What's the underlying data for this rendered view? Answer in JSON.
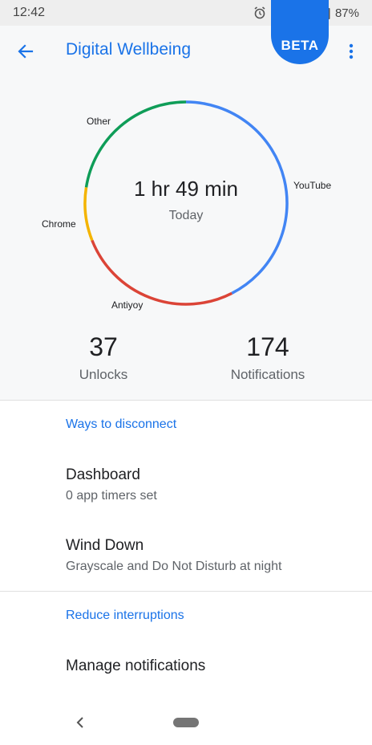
{
  "status_bar": {
    "time": "12:42",
    "battery": "87%",
    "icons": [
      "alarm-icon",
      "bluetooth-icon",
      "wifi-icon",
      "signal-icon",
      "battery-icon"
    ]
  },
  "app_bar": {
    "title": "Digital Wellbeing",
    "badge": "BETA"
  },
  "colors": {
    "accent": "#1a73e8",
    "youtube": "#4285f4",
    "antiyoy": "#db4437",
    "chrome": "#f4b400",
    "other": "#0f9d58"
  },
  "usage": {
    "total": "1 hr 49 min",
    "period": "Today",
    "segments": [
      {
        "app": "YouTube",
        "color": "#4285f4",
        "fraction": 0.425
      },
      {
        "app": "Antiyoy",
        "color": "#db4437",
        "fraction": 0.265
      },
      {
        "app": "Chrome",
        "color": "#f4b400",
        "fraction": 0.085
      },
      {
        "app": "Other",
        "color": "#0f9d58",
        "fraction": 0.225
      }
    ]
  },
  "stats": {
    "unlocks_count": "37",
    "unlocks_label": "Unlocks",
    "notifications_count": "174",
    "notifications_label": "Notifications"
  },
  "sections": {
    "disconnect_header": "Ways to disconnect",
    "dashboard_title": "Dashboard",
    "dashboard_sub": "0 app timers set",
    "wind_down_title": "Wind Down",
    "wind_down_sub": "Grayscale and Do Not Disturb at night",
    "interruptions_header": "Reduce interruptions",
    "manage_notifications_title": "Manage notifications"
  }
}
